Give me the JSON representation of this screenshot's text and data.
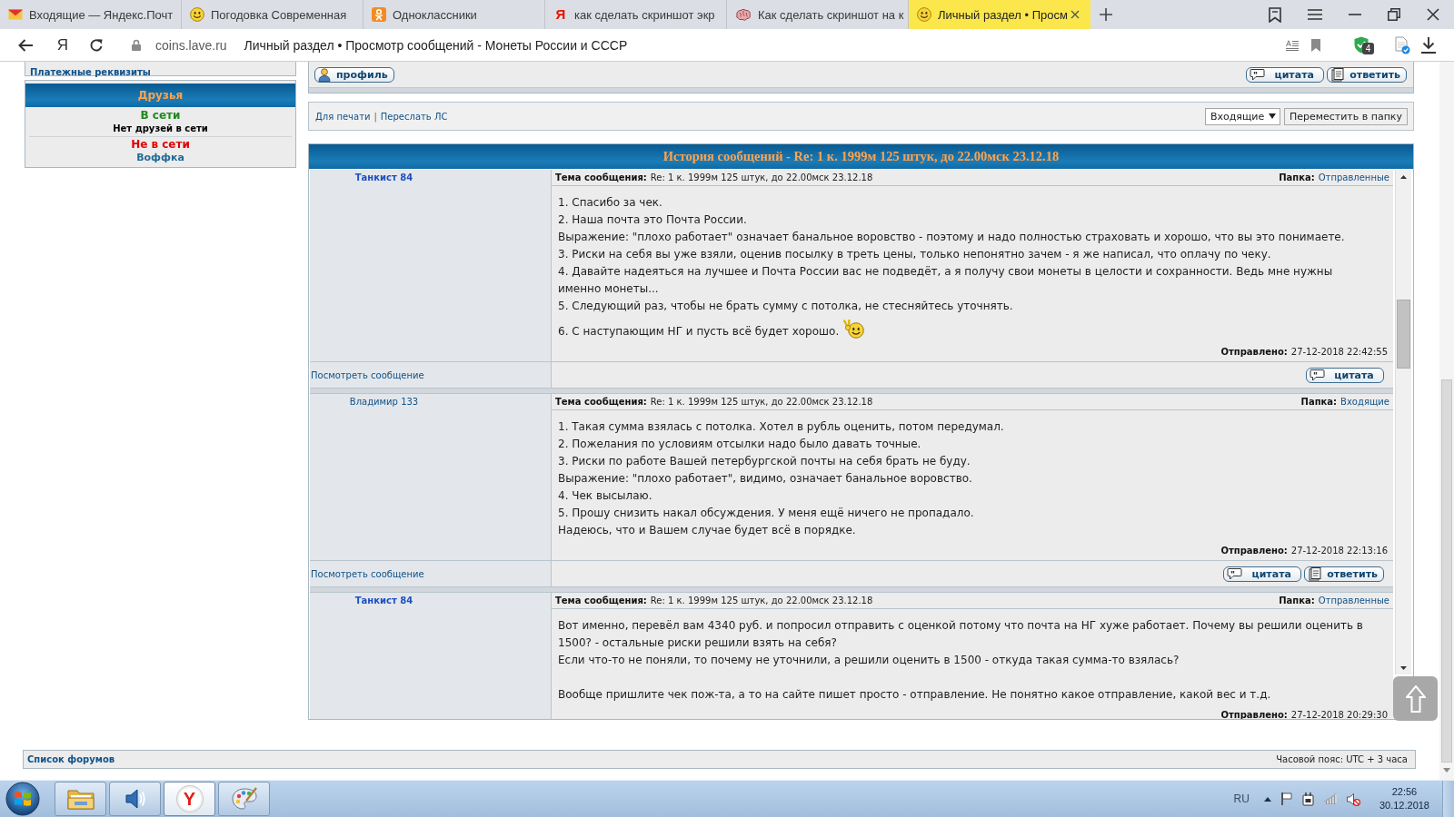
{
  "browser": {
    "tabs": [
      {
        "kind": "mail",
        "title": "Входящие — Яндекс.Почт",
        "selected": false
      },
      {
        "kind": "smiley",
        "title": "Погодовка Современная",
        "selected": false
      },
      {
        "kind": "ok",
        "title": "Одноклассники",
        "selected": false
      },
      {
        "kind": "letter",
        "glyph": "Я",
        "title": "как сделать скриншот экр",
        "selected": false
      },
      {
        "kind": "brain",
        "title": "Как сделать скриншот на к",
        "selected": false
      },
      {
        "kind": "smiley",
        "title": "Личный раздел • Просм",
        "selected": true
      }
    ],
    "toolbar": {
      "home_glyph": "Я",
      "url": "coins.lave.ru",
      "page_title": "Личный раздел • Просмотр сообщений - Монеты России и СССР",
      "shield_count": "4"
    }
  },
  "sidebar": {
    "link": "Платежные реквизиты",
    "friends": {
      "title": "Друзья",
      "online_label": "В сети",
      "online_empty": "Нет друзей в сети",
      "offline_label": "Не в сети",
      "offline": [
        "Воффка"
      ]
    }
  },
  "message_bar": {
    "profile_button": "профиль",
    "buttons": [
      {
        "kind": "quote",
        "label": "цитата"
      },
      {
        "kind": "reply",
        "label": "ответить"
      }
    ]
  },
  "actions": {
    "links": [
      "Для печати",
      "Переслать ЛС"
    ],
    "separator": "|",
    "folder_select": "Входящие",
    "move_button": "Переместить в папку"
  },
  "history": {
    "title": "История сообщений - Re: 1 к. 1999м 125 штук, до 22.00мск 23.12.18",
    "messages": [
      {
        "kind": "sent",
        "author": "Танкист 84",
        "subject_label": "Тема сообщения:",
        "subject": "Re: 1 к. 1999м 125 штук, до 22.00мск 23.12.18",
        "folder_label": "Папка:",
        "folder": "Отправленные",
        "paragraphs": [
          {
            "lines": [
              "1. Спасибо за чек.",
              "2. Наша почта это Почта России.",
              "Выражение: \"плохо работает\" означает банальное воровство - поэтому и надо полностью страховать и хорошо, что вы это понимаете.",
              "3. Риски на себя вы уже взяли, оценив посылку в треть цены, только непонятно зачем - я же написал, что оплачу по чеку.",
              "4. Давайте надеяться на лучшее и Почта России вас не подведёт, а я получу свои монеты в целости и сохранности. Ведь мне нужны именно монеты...",
              "5. Следующий раз, чтобы не брать сумму с потолка, не стесняйтесь уточнять.",
              "6. С наступающим НГ и пусть всё будет хорошо."
            ],
            "smiley": true
          }
        ],
        "sent_label": "Отправлено:",
        "sent": "27-12-2018 22:42:55",
        "view_link": "Посмотреть сообщение",
        "buttons": [
          {
            "kind": "quote",
            "label": "цитата"
          }
        ]
      },
      {
        "kind": "received",
        "author": "Владимир 133",
        "subject_label": "Тема сообщения:",
        "subject": "Re: 1 к. 1999м 125 штук, до 22.00мск 23.12.18",
        "folder_label": "Папка:",
        "folder": "Входящие",
        "paragraphs": [
          {
            "lines": [
              "1. Такая сумма взялась с потолка. Хотел в рубль оценить, потом передумал.",
              "2. Пожелания по условиям отсылки надо было давать точные.",
              "3. Риски по работе Вашей петербургской почты на себя брать не буду.",
              "Выражение: \"плохо работает\", видимо, означает банальное воровство.",
              "4. Чек высылаю.",
              "5. Прошу снизить накал обсуждения. У меня ещё ничего не пропадало.",
              "Надеюсь, что и Вашем случае будет всё в порядке."
            ],
            "smiley": false
          }
        ],
        "sent_label": "Отправлено:",
        "sent": "27-12-2018 22:13:16",
        "view_link": "Посмотреть сообщение",
        "buttons": [
          {
            "kind": "quote",
            "label": "цитата"
          },
          {
            "kind": "reply",
            "label": "ответить"
          }
        ]
      },
      {
        "kind": "sent",
        "author": "Танкист 84",
        "subject_label": "Тема сообщения:",
        "subject": "Re: 1 к. 1999м 125 штук, до 22.00мск 23.12.18",
        "folder_label": "Папка:",
        "folder": "Отправленные",
        "paragraphs": [
          {
            "lines": [
              "Вот именно, перевёл вам 4340 руб. и попросил отправить с оценкой потому что почта на НГ хуже работает. Почему вы решили оценить в 1500? - остальные риски решили взять на себя?",
              "Если что-то не поняли, то почему не уточнили, а решили оценить в 1500 - откуда такая сумма-то взялась?"
            ],
            "smiley": false
          },
          {
            "lines": [
              "Вообще пришлите чек пож-та, а то на сайте пишет просто - отправление. Не понятно какое отправление, какой вес и т.д."
            ],
            "smiley": false
          }
        ],
        "sent_label": "Отправлено:",
        "sent": "27-12-2018 20:29:30"
      }
    ]
  },
  "footer": {
    "link": "Список форумов",
    "timezone": "Часовой пояс: UTC + 3 часа"
  },
  "taskbar": {
    "apps": [
      {
        "kind": "explorer",
        "selected": false
      },
      {
        "kind": "media",
        "selected": false
      },
      {
        "kind": "browser",
        "glyph": "Y",
        "selected": true
      },
      {
        "kind": "paint",
        "selected": false
      }
    ],
    "language": "RU",
    "time": "22:56",
    "date": "30.12.2018"
  }
}
